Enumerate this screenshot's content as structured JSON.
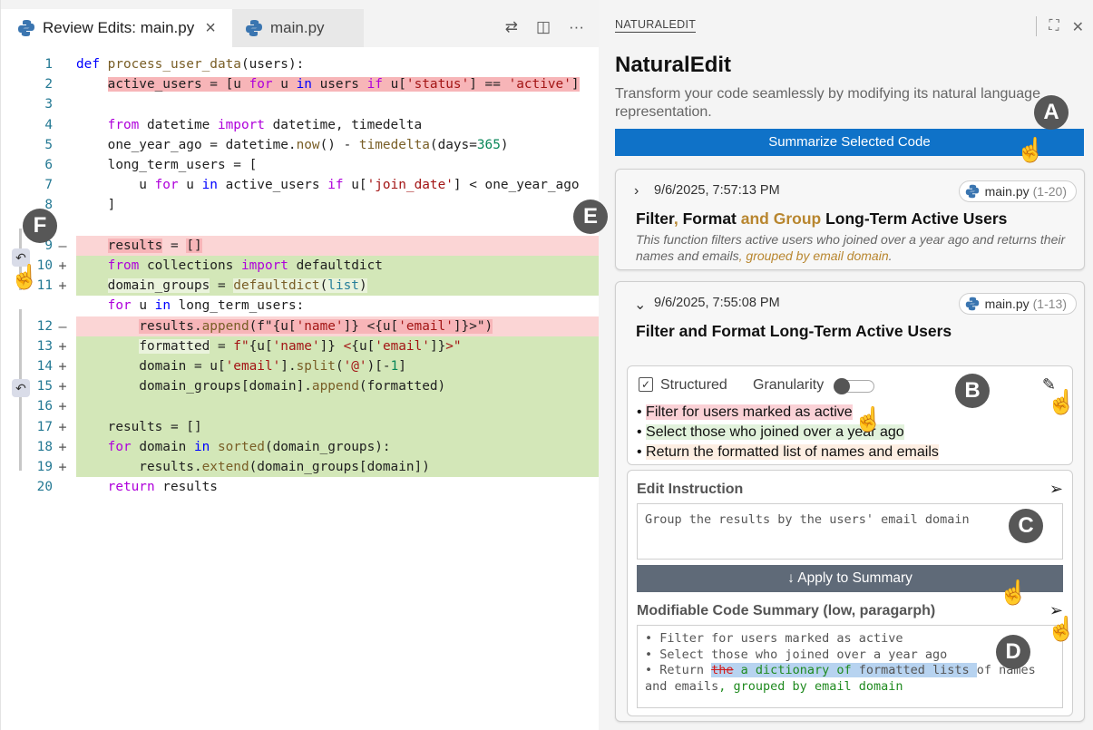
{
  "editor": {
    "tabs": [
      {
        "label": "Review Edits: main.py",
        "close": "×"
      },
      {
        "label": "main.py"
      }
    ],
    "actions": [
      "⇄",
      "◫",
      "···"
    ],
    "lines": [
      {
        "n": "1",
        "mark": "",
        "type": "ctx",
        "html": "<span class='kw'>def</span> <span class='fn'>process_user_data</span>(users):"
      },
      {
        "n": "2",
        "mark": "",
        "type": "ctx",
        "html": "    <span class='hl-red'>active_users = [u <span class='kw2'>for</span> u <span class='kw'>in</span> users <span class='kw2'>if</span> u[<span class='str'>'status'</span>] == <span class='str'>'active'</span>]</span>"
      },
      {
        "n": "3",
        "mark": "",
        "type": "ctx",
        "html": ""
      },
      {
        "n": "4",
        "mark": "",
        "type": "ctx",
        "html": "    <span class='kw2'>from</span> datetime <span class='kw2'>import</span> datetime, timedelta"
      },
      {
        "n": "5",
        "mark": "",
        "type": "ctx",
        "html": "    one_year_ago = datetime.<span class='fn'>now</span>() - <span class='fn'>timedelta</span>(days=<span class='num-lit'>365</span>)"
      },
      {
        "n": "6",
        "mark": "",
        "type": "ctx",
        "html": "    long_term_users = ["
      },
      {
        "n": "7",
        "mark": "",
        "type": "ctx",
        "html": "        u <span class='kw2'>for</span> u <span class='kw'>in</span> active_users <span class='kw2'>if</span> u[<span class='str'>'join_date'</span>] &lt; one_year_ago"
      },
      {
        "n": "8",
        "mark": "",
        "type": "ctx",
        "html": "    ]"
      },
      {
        "n": "",
        "mark": "",
        "type": "ctx",
        "html": ""
      },
      {
        "n": "9",
        "mark": "—",
        "type": "del",
        "html": "    <span class='hl-red'>results</span> = <span class='hl-red'>[]</span>"
      },
      {
        "n": "10",
        "mark": "+",
        "type": "add",
        "html": "    <span class='kw2'>from</span> collections <span class='kw2'>import</span> defaultdict"
      },
      {
        "n": "11",
        "mark": "+",
        "type": "add",
        "html": "    <span class='hl-green'>domain_groups</span> = <span class='hl-green'><span class='fn'>defaultdict</span>(<span class='cls'>list</span>)</span>"
      },
      {
        "n": "",
        "mark": "",
        "type": "ctx",
        "html": "    <span class='kw2'>for</span> u <span class='kw'>in</span> long_term_users:"
      },
      {
        "n": "12",
        "mark": "—",
        "type": "del",
        "html": "        <span class='hl-red'>results.<span class='fn'>append</span>(f\"{u[<span class='str'>'name'</span>]} &lt;{u[<span class='str'>'email'</span>]}&gt;\")</span>"
      },
      {
        "n": "13",
        "mark": "+",
        "type": "add",
        "html": "        <span class='hl-green'>formatted</span> = <span class='str'>f\"</span>{u[<span class='str'>'name'</span>]} <span class='str'>&lt;</span>{u[<span class='str'>'email'</span>]}<span class='str'>&gt;\"</span>"
      },
      {
        "n": "14",
        "mark": "+",
        "type": "add",
        "html": "        domain = u[<span class='str'>'email'</span>].<span class='fn'>split</span>(<span class='str'>'@'</span>)[-<span class='num-lit'>1</span>]"
      },
      {
        "n": "15",
        "mark": "+",
        "type": "add",
        "html": "        domain_groups[domain].<span class='fn'>append</span>(formatted)"
      },
      {
        "n": "16",
        "mark": "+",
        "type": "add",
        "html": ""
      },
      {
        "n": "17",
        "mark": "+",
        "type": "add",
        "html": "    results = []"
      },
      {
        "n": "18",
        "mark": "+",
        "type": "add",
        "html": "    <span class='kw2'>for</span> domain <span class='kw'>in</span> <span class='fn'>sorted</span>(domain_groups):"
      },
      {
        "n": "19",
        "mark": "+",
        "type": "add",
        "html": "        results.<span class='fn'>extend</span>(domain_groups[domain])"
      },
      {
        "n": "20",
        "mark": "",
        "type": "ctx",
        "html": "    <span class='kw2'>return</span> results"
      }
    ]
  },
  "panel": {
    "header": "NATURALEDIT",
    "title": "NaturalEdit",
    "description": "Transform your code seamlessly by modifying its natural language representation.",
    "summarize_button": "Summarize Selected Code",
    "card1": {
      "chevron": "›",
      "timestamp": "9/6/2025, 7:57:13 PM",
      "file": "main.py",
      "range": "(1-20)",
      "title_html": "Filter<span class='hl'>,</span> Format <span class='hl'>and Group</span> Long-Term Active Users",
      "subtitle_html": "This function filters active users who joined over a year ago and returns their names and emails<span class='hl'>, grouped by email domain</span>."
    },
    "card2": {
      "chevron": "⌄",
      "timestamp": "9/6/2025, 7:55:08 PM",
      "file": "main.py",
      "range": "(1-13)",
      "title": "Filter and Format Long-Term Active Users",
      "structured_label": "Structured",
      "granularity_label": "Granularity",
      "bullets_html": "• <span class='b1'>Filter for users marked as active</span><br>• <span class='b2'>Select those who joined over a year ago</span><br>• <span class='b3'>Return the formatted list of names and emails</span>",
      "edit_instruction_label": "Edit Instruction",
      "edit_instruction_value": "Group the results by the users' email domain",
      "apply_button": "↓  Apply to Summary",
      "modifiable_label": "Modifiable Code Summary (low, paragarph)",
      "modifiable_html": "• Filter for users marked as active<br>• Select those who joined over a year ago<br>• Return <span class='sel'><span class='strike'>the</span><span class='ins'> a dictionary of</span> formatted lists </span>of names<br>and emails<span class='ins'>, grouped by email domain</span>"
    }
  },
  "badges": [
    "A",
    "B",
    "C",
    "D",
    "E",
    "F"
  ]
}
